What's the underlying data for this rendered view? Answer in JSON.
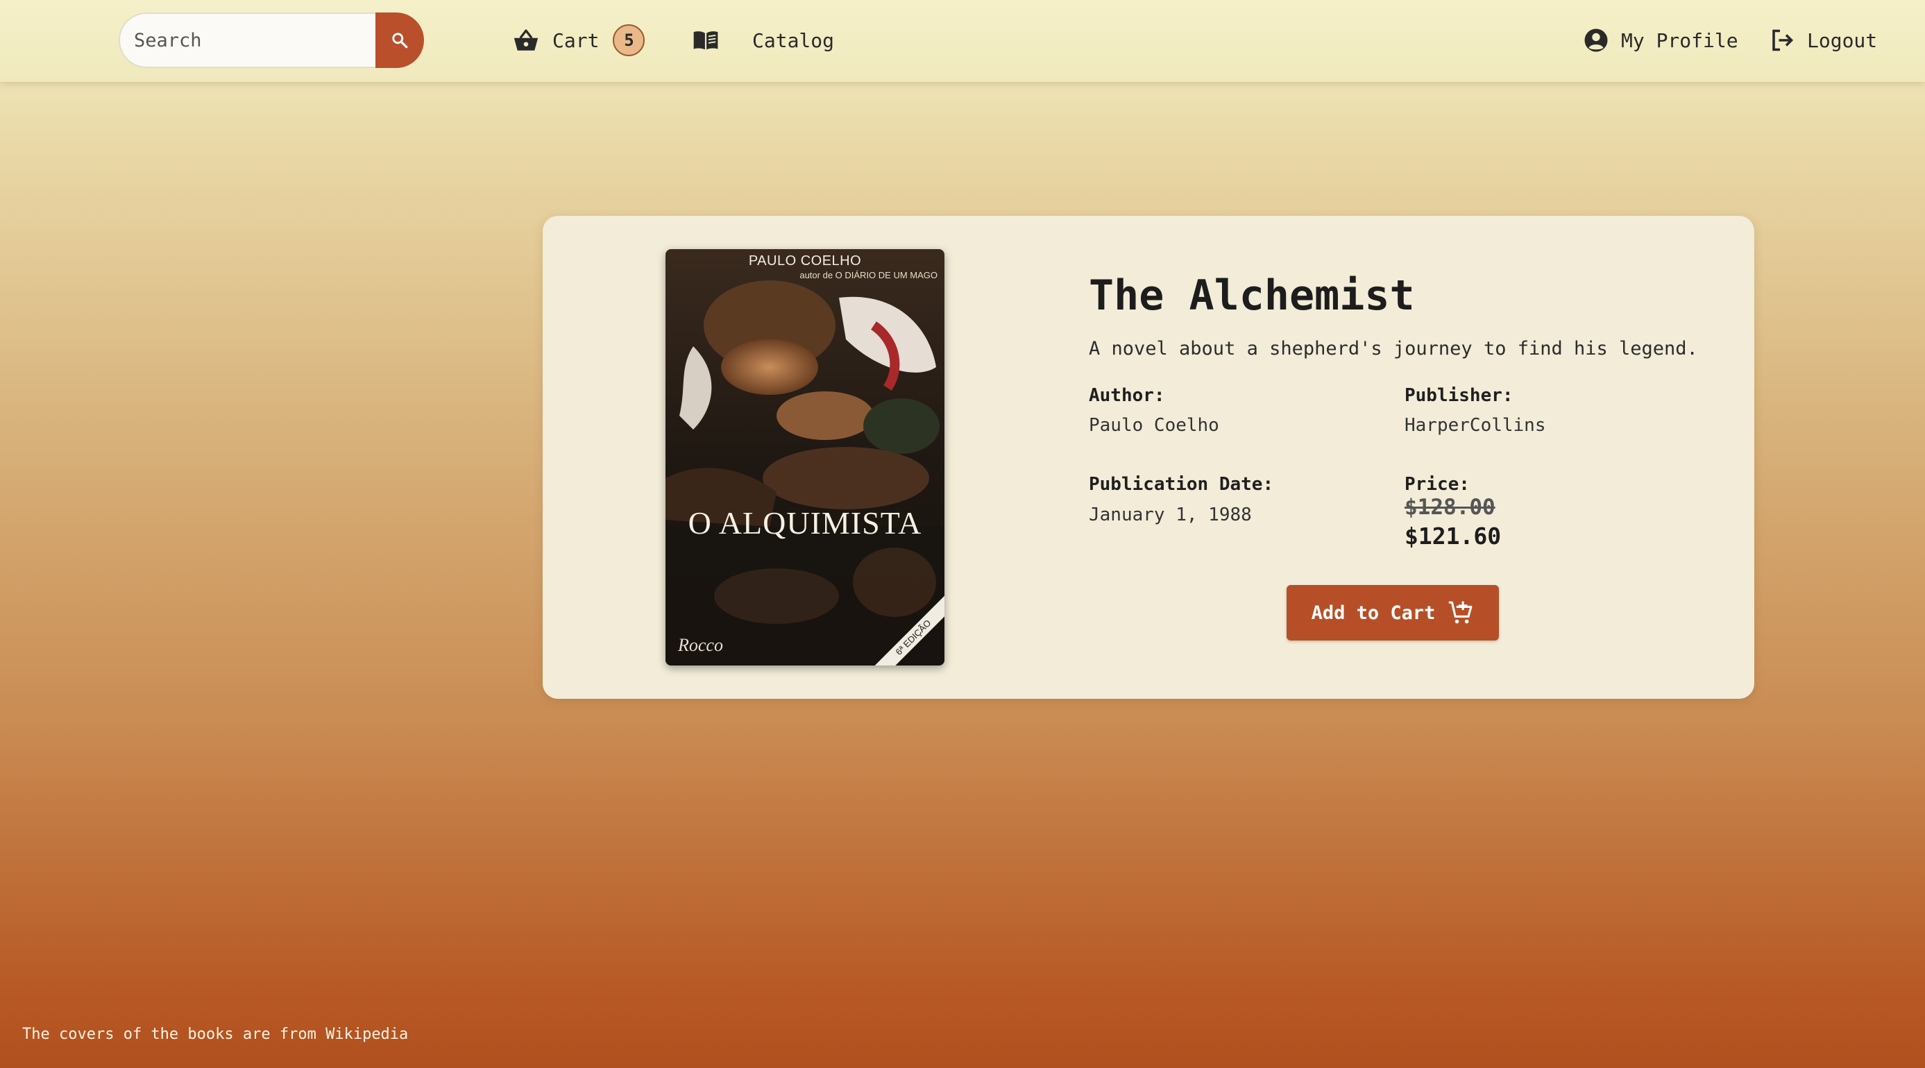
{
  "nav": {
    "search_placeholder": "Search",
    "cart_label": "Cart",
    "cart_count": "5",
    "catalog_label": "Catalog",
    "profile_label": "My Profile",
    "logout_label": "Logout",
    "icons": {
      "search": "search-icon",
      "cart": "basket-icon",
      "catalog": "open-book-icon",
      "profile": "account-circle-icon",
      "logout": "logout-icon"
    }
  },
  "book": {
    "title": "The Alchemist",
    "description": "A novel about a shepherd's journey to find his legend.",
    "author_label": "Author:",
    "author": "Paulo Coelho",
    "publisher_label": "Publisher:",
    "publisher": "HarperCollins",
    "pubdate_label": "Publication Date:",
    "pubdate": "January 1, 1988",
    "price_label": "Price:",
    "original_price": "$128.00",
    "sale_price": "$121.60",
    "add_to_cart_label": "Add to Cart",
    "cover": {
      "author": "PAULO COELHO",
      "subtitle": "autor de O DIÁRIO DE UM MAGO",
      "title": "O ALQUIMISTA",
      "publisher_mark": "Rocco",
      "edition": "6ª EDIÇÃO"
    }
  },
  "footer": {
    "note": "The covers of the books are from Wikipedia"
  },
  "colors": {
    "accent": "#b9502b",
    "card_bg": "#f2ecd8",
    "navbar_bg": "#f3eec5",
    "badge_bg": "#e9b98a"
  }
}
